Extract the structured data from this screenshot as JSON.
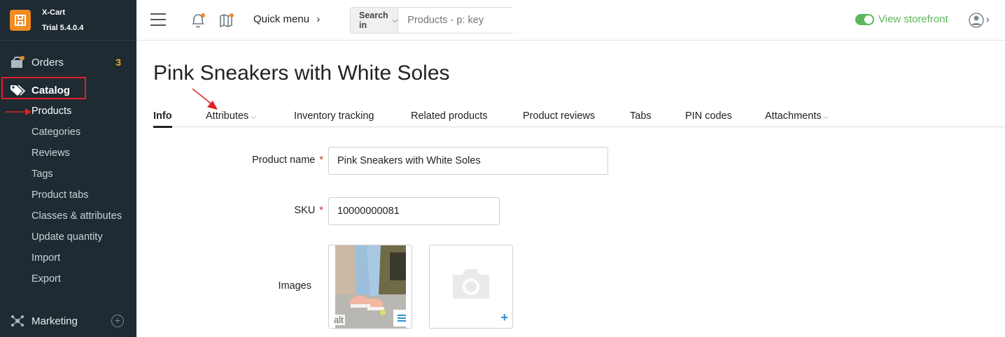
{
  "brand": {
    "name": "X-Cart",
    "version": "Trial 5.4.0.4",
    "accent": "#f28b22"
  },
  "sidebar": {
    "orders": {
      "label": "Orders",
      "badge": "3"
    },
    "catalog": {
      "label": "Catalog"
    },
    "catalog_items": [
      {
        "label": "Products"
      },
      {
        "label": "Categories"
      },
      {
        "label": "Reviews"
      },
      {
        "label": "Tags"
      },
      {
        "label": "Product tabs"
      },
      {
        "label": "Classes & attributes"
      },
      {
        "label": "Update quantity"
      },
      {
        "label": "Import"
      },
      {
        "label": "Export"
      }
    ],
    "marketing": {
      "label": "Marketing"
    }
  },
  "header": {
    "quick_menu": "Quick menu",
    "search_in": "Search in",
    "search_placeholder": "Products - p: key",
    "storefront": "View storefront",
    "storefront_color": "#5cb85c"
  },
  "page": {
    "title": "Pink Sneakers with White Soles",
    "tabs": [
      {
        "label": "Info"
      },
      {
        "label": "Attributes"
      },
      {
        "label": "Inventory tracking"
      },
      {
        "label": "Related products"
      },
      {
        "label": "Product reviews"
      },
      {
        "label": "Tabs"
      },
      {
        "label": "PIN codes"
      },
      {
        "label": "Attachments"
      }
    ]
  },
  "form": {
    "product_name_label": "Product name",
    "product_name_value": "Pink Sneakers with White Soles",
    "sku_label": "SKU",
    "sku_value": "10000000081",
    "required_mark": "*",
    "images_label": "Images",
    "image_alt_label": "alt"
  }
}
